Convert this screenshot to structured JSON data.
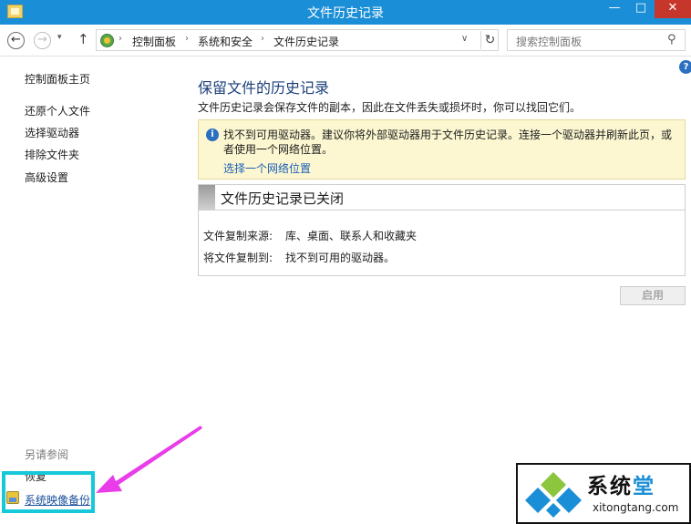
{
  "window": {
    "title": "文件历史记录",
    "controls": {
      "minimize": "—",
      "maximize": "□",
      "close": "✕"
    }
  },
  "nav": {
    "back_glyph": "←",
    "forward_glyph": "→",
    "recent_glyph": "▾",
    "up_glyph": "↑",
    "breadcrumbs": [
      "控制面板",
      "系统和安全",
      "文件历史记录"
    ],
    "separator": "›",
    "dropdown_glyph": "∨",
    "refresh_glyph": "↻",
    "search_placeholder": "搜索控制面板",
    "search_glyph": "⚲"
  },
  "help_glyph": "?",
  "sidebar": {
    "home": "控制面板主页",
    "items": [
      {
        "label": "还原个人文件"
      },
      {
        "label": "选择驱动器"
      },
      {
        "label": "排除文件夹"
      },
      {
        "label": "高级设置"
      }
    ],
    "see_also": "另请参阅",
    "see_also_items": [
      {
        "label": "恢复"
      },
      {
        "label": "系统映像备份"
      }
    ]
  },
  "main": {
    "title": "保留文件的历史记录",
    "description": "文件历史记录会保存文件的副本，因此在文件丢失或损坏时，你可以找回它们。",
    "notice": {
      "icon_glyph": "i",
      "text": "找不到可用驱动器。建议你将外部驱动器用于文件历史记录。连接一个驱动器并刷新此页，或者使用一个网络位置。",
      "link": "选择一个网络位置"
    },
    "status": {
      "title": "文件历史记录已关闭",
      "rows": [
        {
          "label": "文件复制来源:",
          "value": "库、桌面、联系人和收藏夹"
        },
        {
          "label": "将文件复制到:",
          "value": "找不到可用的驱动器。"
        }
      ]
    },
    "enable_button": "启用"
  },
  "watermark": {
    "text_a": "系统",
    "text_b": "堂",
    "url": "xitongtang.com"
  },
  "colors": {
    "titlebar": "#1a8ed6",
    "annotation_box": "#17c8d9",
    "annotation_arrow": "#e83de8",
    "notice_bg": "#fcf7d1",
    "link": "#1a5fb4"
  }
}
